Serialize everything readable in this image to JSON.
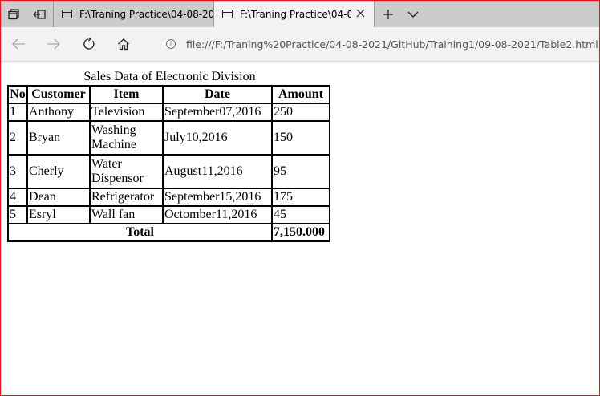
{
  "browser": {
    "tabs": [
      {
        "title": "F:\\Traning Practice\\04-08-20",
        "active": false
      },
      {
        "title": "F:\\Traning Practice\\04-0",
        "active": true
      }
    ],
    "address_url": "file:///F:/Traning%20Practice/04-08-2021/GitHub/Training1/09-08-2021/Table2.html",
    "colors": {
      "tabstrip": "#cccccc",
      "toolbar": "#f2f2f2",
      "window_border": "#e81123"
    }
  },
  "page": {
    "caption": "Sales Data of Electronic Division",
    "headers": [
      "No",
      "Customer",
      "Item",
      "Date",
      "Amount"
    ],
    "rows": [
      {
        "no": "1",
        "customer": "Anthony",
        "item": "Television",
        "date": "September07,2016",
        "amount": "250"
      },
      {
        "no": "2",
        "customer": "Bryan",
        "item": "Washing Machine",
        "date": "July10,2016",
        "amount": "150"
      },
      {
        "no": "3",
        "customer": "Cherly",
        "item": "Water Dispensor",
        "date": "August11,2016",
        "amount": "95"
      },
      {
        "no": "4",
        "customer": "Dean",
        "item": "Refrigerator",
        "date": "September15,2016",
        "amount": "175"
      },
      {
        "no": "5",
        "customer": "Esryl",
        "item": "Wall fan",
        "date": "Octomber11,2016",
        "amount": "45"
      }
    ],
    "total_label": "Total",
    "total_value": "7,150.000"
  }
}
